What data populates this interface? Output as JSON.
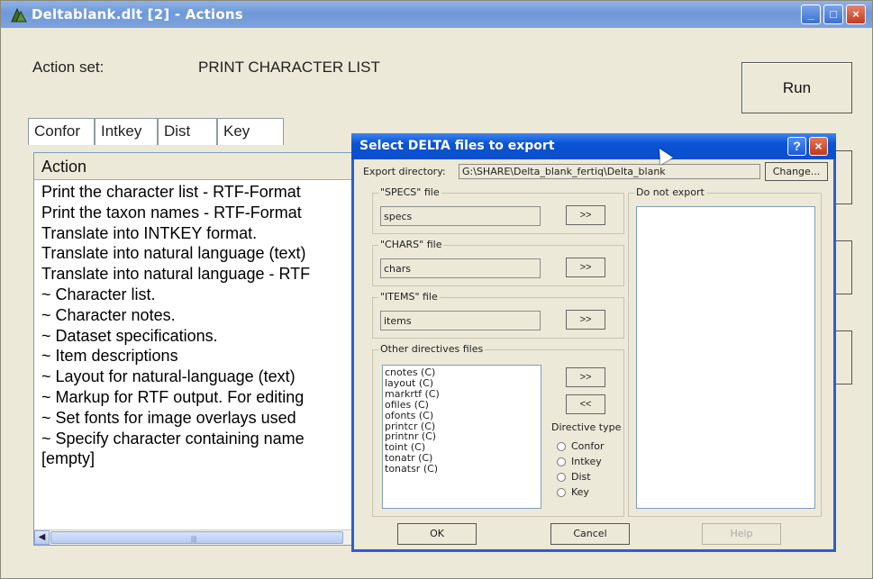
{
  "window": {
    "title": "Deltablank.dlt [2] - Actions",
    "controls": {
      "minimize": "_",
      "maximize": "□",
      "close": "×"
    }
  },
  "action_set": {
    "label": "Action set:",
    "value": "PRINT CHARACTER LIST"
  },
  "run_button": "Run",
  "tabs": [
    "Confor",
    "Intkey",
    "Dist",
    "Key"
  ],
  "action_list": {
    "header": "Action",
    "items": [
      "Print the character list - RTF-Format",
      "Print the taxon names - RTF-Format",
      "Translate into INTKEY format.",
      "Translate into natural language (text)",
      "Translate into natural language - RTF",
      "~ Character list.",
      "~ Character notes.",
      "~ Dataset specifications.",
      "~ Item descriptions",
      "~ Layout for natural-language (text)",
      "~ Markup for RTF output. For editing",
      "~ Set fonts for image overlays used",
      "~ Specify character containing name",
      "[empty]"
    ]
  },
  "dialog": {
    "title": "Select DELTA files to export",
    "title_buttons": {
      "help": "?",
      "close": "×"
    },
    "export_directory_label": "Export directory:",
    "export_directory_value": "G:\\SHARE\\Delta_blank_fertiq\\Delta_blank",
    "change_button": "Change...",
    "specs": {
      "label": "\"SPECS\" file",
      "value": "specs",
      "button": ">>"
    },
    "chars": {
      "label": "\"CHARS\" file",
      "value": "chars",
      "button": ">>"
    },
    "items": {
      "label": "\"ITEMS\" file",
      "value": "items",
      "button": ">>"
    },
    "other": {
      "label": "Other directives files",
      "files": [
        "cnotes (C)",
        "layout (C)",
        "markrtf (C)",
        "ofiles (C)",
        "ofonts (C)",
        "printcr (C)",
        "printnr (C)",
        "toint (C)",
        "tonatr (C)",
        "tonatsr (C)"
      ],
      "add_button": ">>",
      "remove_button": "<<",
      "directive_type_label": "Directive type",
      "directive_types": [
        "Confor",
        "Intkey",
        "Dist",
        "Key"
      ]
    },
    "do_not_export_label": "Do not export",
    "ok_button": "OK",
    "cancel_button": "Cancel",
    "help_button": "Help"
  }
}
